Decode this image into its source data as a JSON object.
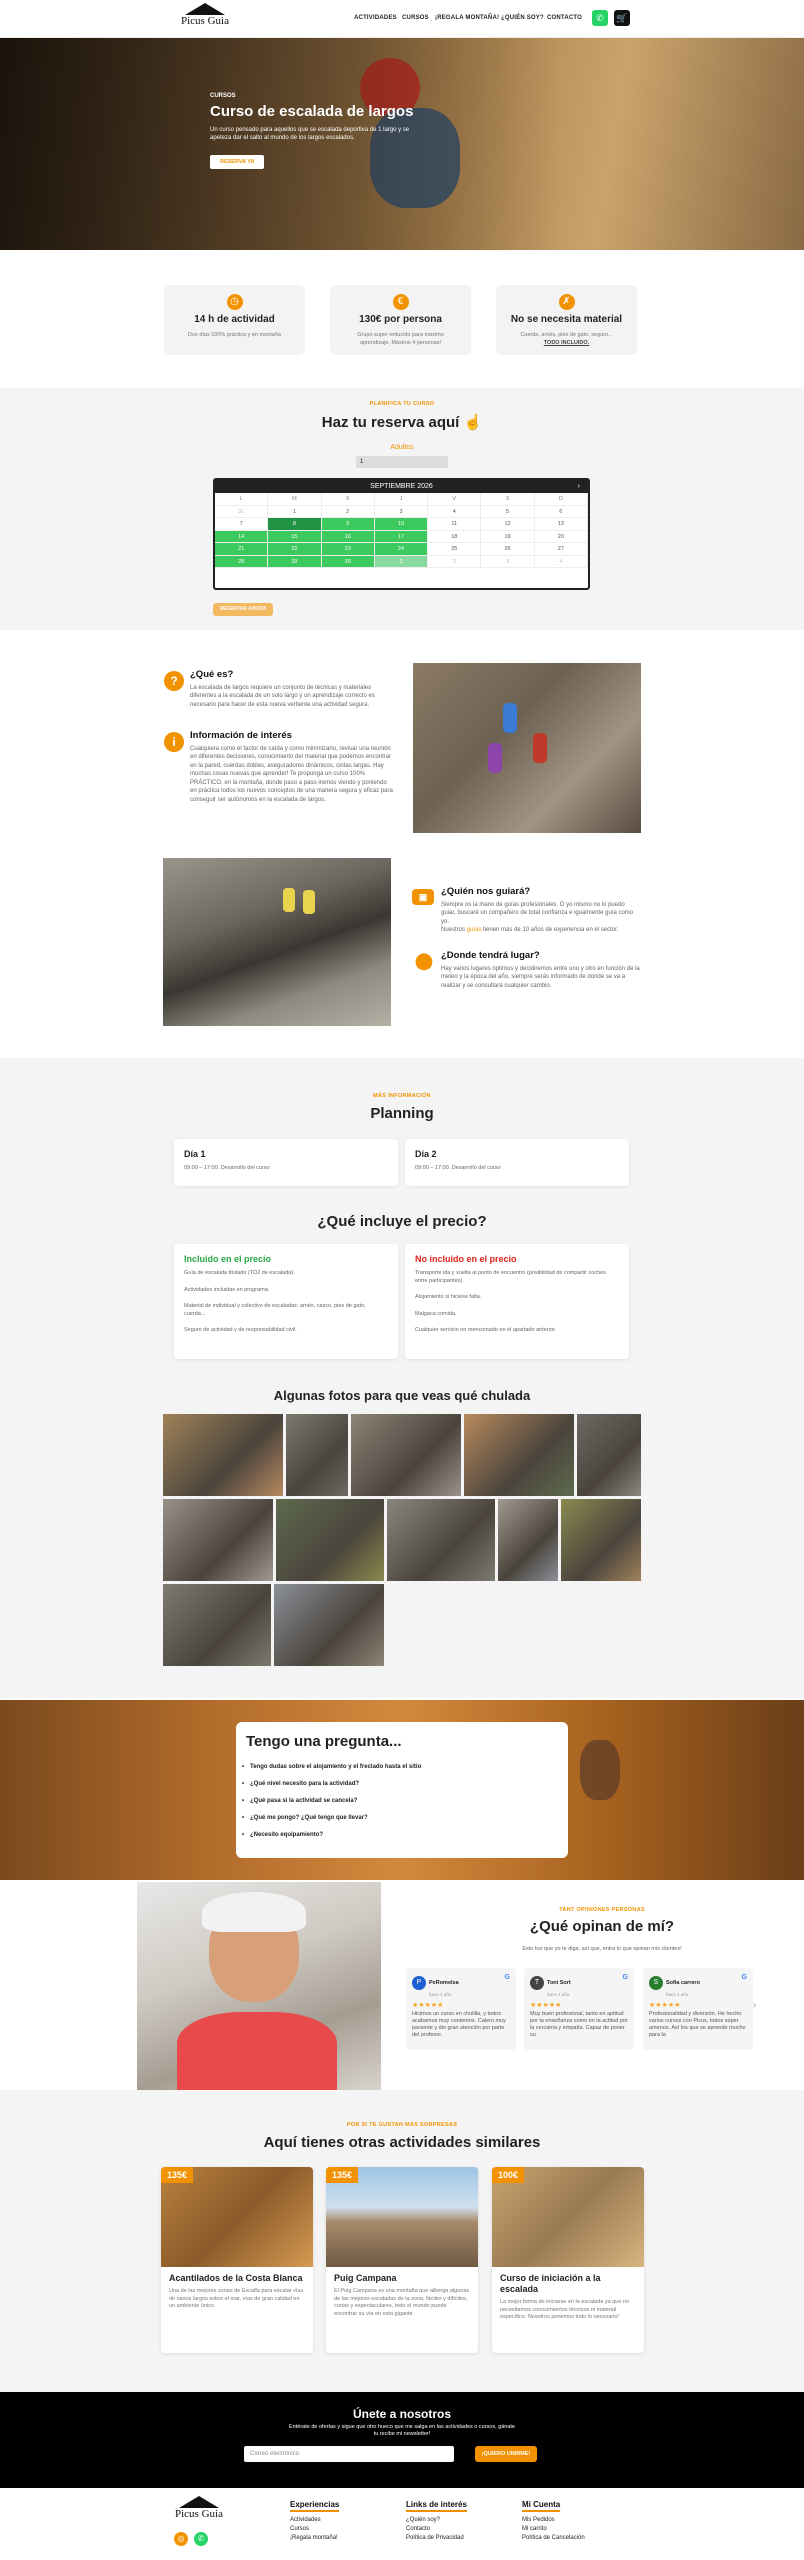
{
  "brand": {
    "name": "Picus Guia"
  },
  "nav": [
    "ACTIVIDADES",
    "CURSOS",
    "¡REGALA MONTAÑA!",
    "¿QUIÉN SOY?",
    "CONTACTO"
  ],
  "hero": {
    "kicker": "CURSOS",
    "title": "Curso de escalada de largos",
    "desc": "Un curso pensado para aquellos que se escalada deportiva de 1 largo y se apeteza dar el salto al mundo de los largos escalados.",
    "cta": "RESERVA YA"
  },
  "features": [
    {
      "icon": "clock-icon",
      "glyph": "◷",
      "title": "14 h de actividad",
      "desc": "Dos días 100% práctica y en montaña"
    },
    {
      "icon": "euro-icon",
      "glyph": "€",
      "title": "130€ por persona",
      "desc": "Grupo super reducido para máximo aprendizaje. Máximo 4 personas!"
    },
    {
      "icon": "no-material-icon",
      "glyph": "✗",
      "title": "No se necesita material",
      "desc": "Cuerda, arnés, pies de gato, seguro...",
      "desc2": "TODO INCLUIDO."
    }
  ],
  "reserve": {
    "kicker": "PLANIFICA TU CURSO",
    "title": "Haz tu reserva aquí",
    "adults_label": "Adultos",
    "adults_value": "1",
    "month": "SEPTIEMBRE 2026",
    "button": "RESERVAR AHORA",
    "dow": [
      "L",
      "M",
      "X",
      "J",
      "V",
      "S",
      "D"
    ],
    "weeks": [
      [
        "31",
        "1",
        "2",
        "3",
        "4",
        "5",
        "6"
      ],
      [
        "7",
        "8",
        "9",
        "10",
        "11",
        "12",
        "13"
      ],
      [
        "14",
        "15",
        "16",
        "17",
        "18",
        "19",
        "20"
      ],
      [
        "21",
        "22",
        "23",
        "24",
        "25",
        "26",
        "27"
      ],
      [
        "28",
        "29",
        "30",
        "1",
        "2",
        "3",
        "4"
      ]
    ]
  },
  "info": {
    "what_title": "¿Qué es?",
    "what_text": "La escalada de largos requiere un conjunto de técnicas y materiales diferentes a la escalada de un solo largo y un aprendizaje correcto es necesario para hacer de esta nueva vertiente una actividad segura.",
    "interest_title": "Información de interés",
    "interest_text": "Cualquiera como el factor de caída y como minimizarlo, revisar una reunión en diferentes decisiones, conocimiento del material que podemos encontrar en la pared, cuerdas dobles, aseguradores dinámicos, cintas largas. Hay muchas cosas nuevas que aprender! Te proponga un curso 100% PRÁCTICO, en la montaña, donde paso a paso iremos viendo y poniendo en práctica todos los nuevos conceptos de una manera segura y eficaz para conseguir ser autónomos en la escalada de largos.",
    "guide_title": "¿Quién nos guiará?",
    "guide_text": "Siempre os la mano de guías profesionales. O yo mismo no lo puedo guiar, buscaré un compañero de total confianza e igualmente guía como yo.",
    "guide_text2": "Nuestros",
    "guide_link": "guías",
    "guide_text3": "tienen más de 10 años de experiencia en el sector.",
    "where_title": "¿Donde tendrá lugar?",
    "where_text": "Hay varios lugares óptimos y decidiremos entre uno y otro en función de la meteo y la época del año, siempre serás informado de donde se va a realizar y se consultará cualquier cambio."
  },
  "planning": {
    "kicker": "MÁS INFORMACIÓN",
    "title": "Planning",
    "days": [
      {
        "t": "Día 1",
        "d": "09:00 – 17:00. Desarrollo del curso"
      },
      {
        "t": "Día 2",
        "d": "09:00 – 17:00. Desarrollo del curso"
      }
    ],
    "incl_title": "¿Qué incluye el precio?",
    "yes_title": "Incluido en el precio",
    "yes": [
      "Guía de escalada titulado (TD2 de escalada).",
      "Actividades incluidas en programa.",
      "Material de individual y colectivo de escaladas: arnés, casco, pies de gato, cuerda...",
      "Seguro de actividad y de responsabilidad civil."
    ],
    "no_title": "No incluido en el precio",
    "no": [
      "Transporte ida y vuelta al punto de encuentro (posibilidad de compartir coches entre participantes).",
      "Alojamiento si hiciese falta.",
      "Malgaca comida.",
      "Cualquier servicio no mencionado en el apartado anterior."
    ],
    "photos_title": "Algunas fotos para que veas qué chulada"
  },
  "faq": {
    "title": "Tengo una pregunta...",
    "items": [
      "Tengo dudas sobre el alojamiento y el freclado hasta el sitio",
      "¿Qué nivel necesito para la actividad?",
      "¿Qué pasa si la actividad se cancela?",
      "¿Qué me pongo? ¿Qué tengo que llevar?",
      "¿Necesito equipamiento?"
    ]
  },
  "reviews": {
    "kicker": "TANT OPINIONES PERSONAS",
    "title": "¿Qué opinan de mí?",
    "sub": "Esto fue que yo te diga, así que, entra lo que opinan mis clientes!",
    "items": [
      {
        "name": "PeRomelsa",
        "date": "hace 1 año",
        "av": "P",
        "color": "#1e5fd1",
        "text": "Hicimos un curso en chulilla, y todos acabamos muy contentos. Calero muy paciente y dio gran atención por parte del profesor."
      },
      {
        "name": "Toni Sort",
        "date": "hace 1 año",
        "av": "T",
        "color": "#444",
        "text": "Muy buen profesional, tanto en aptitud por la enseñanza como en la actitud por la cercanía y empatía. Capaz de poner su"
      },
      {
        "name": "Sofia carrero",
        "date": "hace 1 año",
        "av": "S",
        "color": "#2a7d2e",
        "text": "Profesionalidad y diversión. He hecho varios cursos con Picus, todos súper amenos. Así los que se aprende mucho para la"
      }
    ]
  },
  "acts": {
    "kicker": "POR SI TE GUSTAN MÁS SORPRESAS",
    "title": "Aquí tienes otras actividades similares",
    "items": [
      {
        "price": "135€",
        "title": "Acantilados de la Costa Blanca",
        "desc": "Una de las mejores zonas de Escalfa para escalar vías de varios largos sobre el mar, vías de gran calidad en un ambiente único."
      },
      {
        "price": "135€",
        "title": "Puig Campana",
        "desc": "El Puig Campana es una montaña que alberga algunas de las mejores escaladas de la zona, fáciles y difíciles, cortas y espectaculares, todo el mundo puede encontrar su vía en esta gigante."
      },
      {
        "price": "100€",
        "title": "Curso de iniciación a la escalada",
        "desc": "La mejor forma de iniciarse en la escalada ya que no necesitamos conocimientos técnicos ni material específico. Nosotros ponemos todo lo necesario!"
      }
    ]
  },
  "news": {
    "title": "Únete a nosotros",
    "sub": "Entérate de ofertas y sigue que otro hueco que me salga en las actividades o cursos, gánate tu recibe mi newsletter!",
    "placeholder": "Correo electrónico",
    "button": "¡QUIERO UNIRME!"
  },
  "footer": {
    "cols": [
      {
        "h": "Experiencias",
        "l": [
          "Actividades",
          "Cursos",
          "¡Regala montaña!"
        ]
      },
      {
        "h": "Links de interés",
        "l": [
          "¿Quién soy?",
          "Contacto",
          "Política de Privacidad"
        ]
      },
      {
        "h": "Mi Cuenta",
        "l": [
          "Mis Pedidos",
          "Mi carrito",
          "Política de Cancelación"
        ]
      }
    ]
  }
}
